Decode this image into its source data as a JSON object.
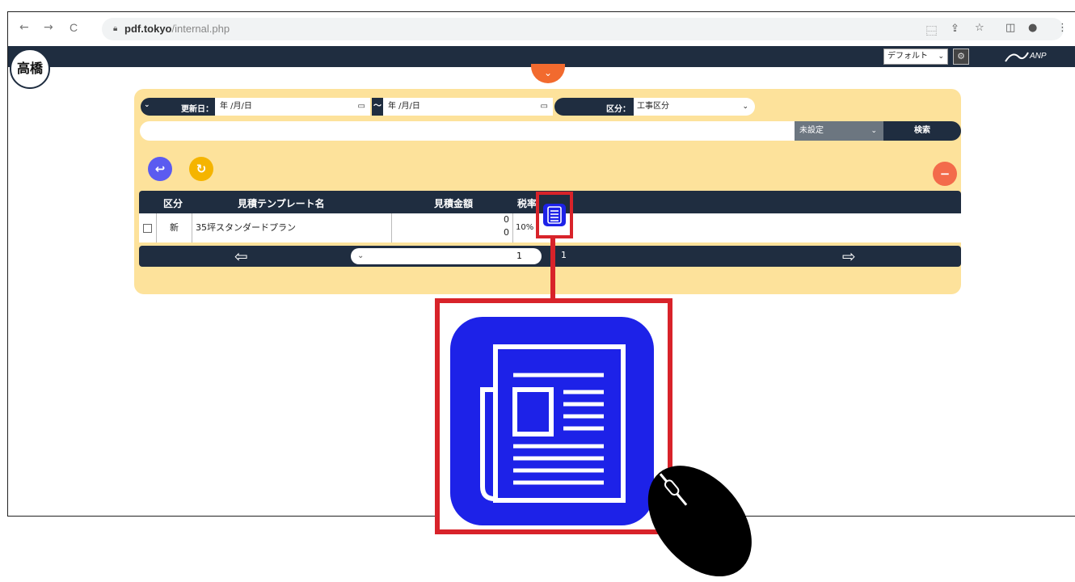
{
  "browser": {
    "url_host": "pdf.tokyo",
    "url_path": "/internal.php",
    "nav": {
      "back": "←",
      "forward": "→",
      "reload": "C"
    },
    "toolbar_icons": [
      "translate-icon",
      "share-icon",
      "star-icon",
      "sidebar-icon",
      "profile-icon",
      "menu-icon"
    ]
  },
  "header": {
    "user_name": "高橋",
    "preset_select": "デフォルト",
    "logo_text": "ANP"
  },
  "filters": {
    "updated_label": "更新日：",
    "date_from_placeholder": "年 /月/日",
    "date_sep": "〜",
    "date_to_placeholder": "年 /月/日",
    "kubun_label": "区分：",
    "kubun_value": "工事区分",
    "status_value": "未設定",
    "search_label": "検索"
  },
  "table": {
    "headers": [
      "区分",
      "見積テンプレート名",
      "見積金額",
      "税率"
    ],
    "rows": [
      {
        "kubun": "新",
        "name": "35坪スタンダードプラン",
        "amount_top": "0",
        "amount_bottom": "0",
        "tax": "10%"
      }
    ]
  },
  "pager": {
    "current_page": "1",
    "total_pages": "1"
  },
  "colors": {
    "navy": "#1f2d40",
    "panel": "#fde29b",
    "accent_orange": "#f26a2e",
    "highlight_red": "#d8232a",
    "icon_blue": "#1d22e8",
    "back_button": "#5b5bf0",
    "refresh_button": "#f5b400",
    "delete_button": "#f36b4b"
  }
}
